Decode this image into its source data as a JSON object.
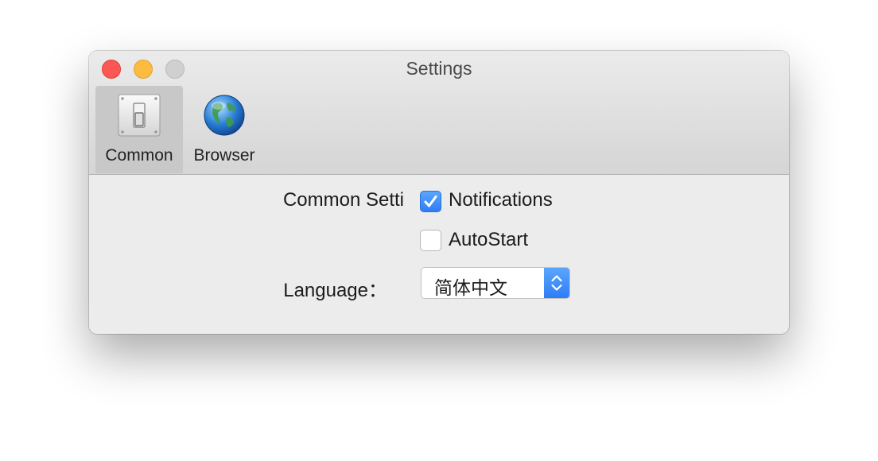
{
  "window": {
    "title": "Settings"
  },
  "toolbar": {
    "items": [
      {
        "label": "Common",
        "icon": "switch-icon",
        "selected": true
      },
      {
        "label": "Browser",
        "icon": "globe-icon",
        "selected": false
      }
    ]
  },
  "common": {
    "section_label": "Common Setti",
    "notifications": {
      "label": "Notifications",
      "checked": true
    },
    "autostart": {
      "label": "AutoStart",
      "checked": false
    },
    "language": {
      "label": "Language：",
      "selected": "简体中文"
    }
  },
  "colors": {
    "accent": "#3b8cf9",
    "close": "#fc5753",
    "minimize": "#fdbc40",
    "zoom": "#d0d0d0"
  }
}
